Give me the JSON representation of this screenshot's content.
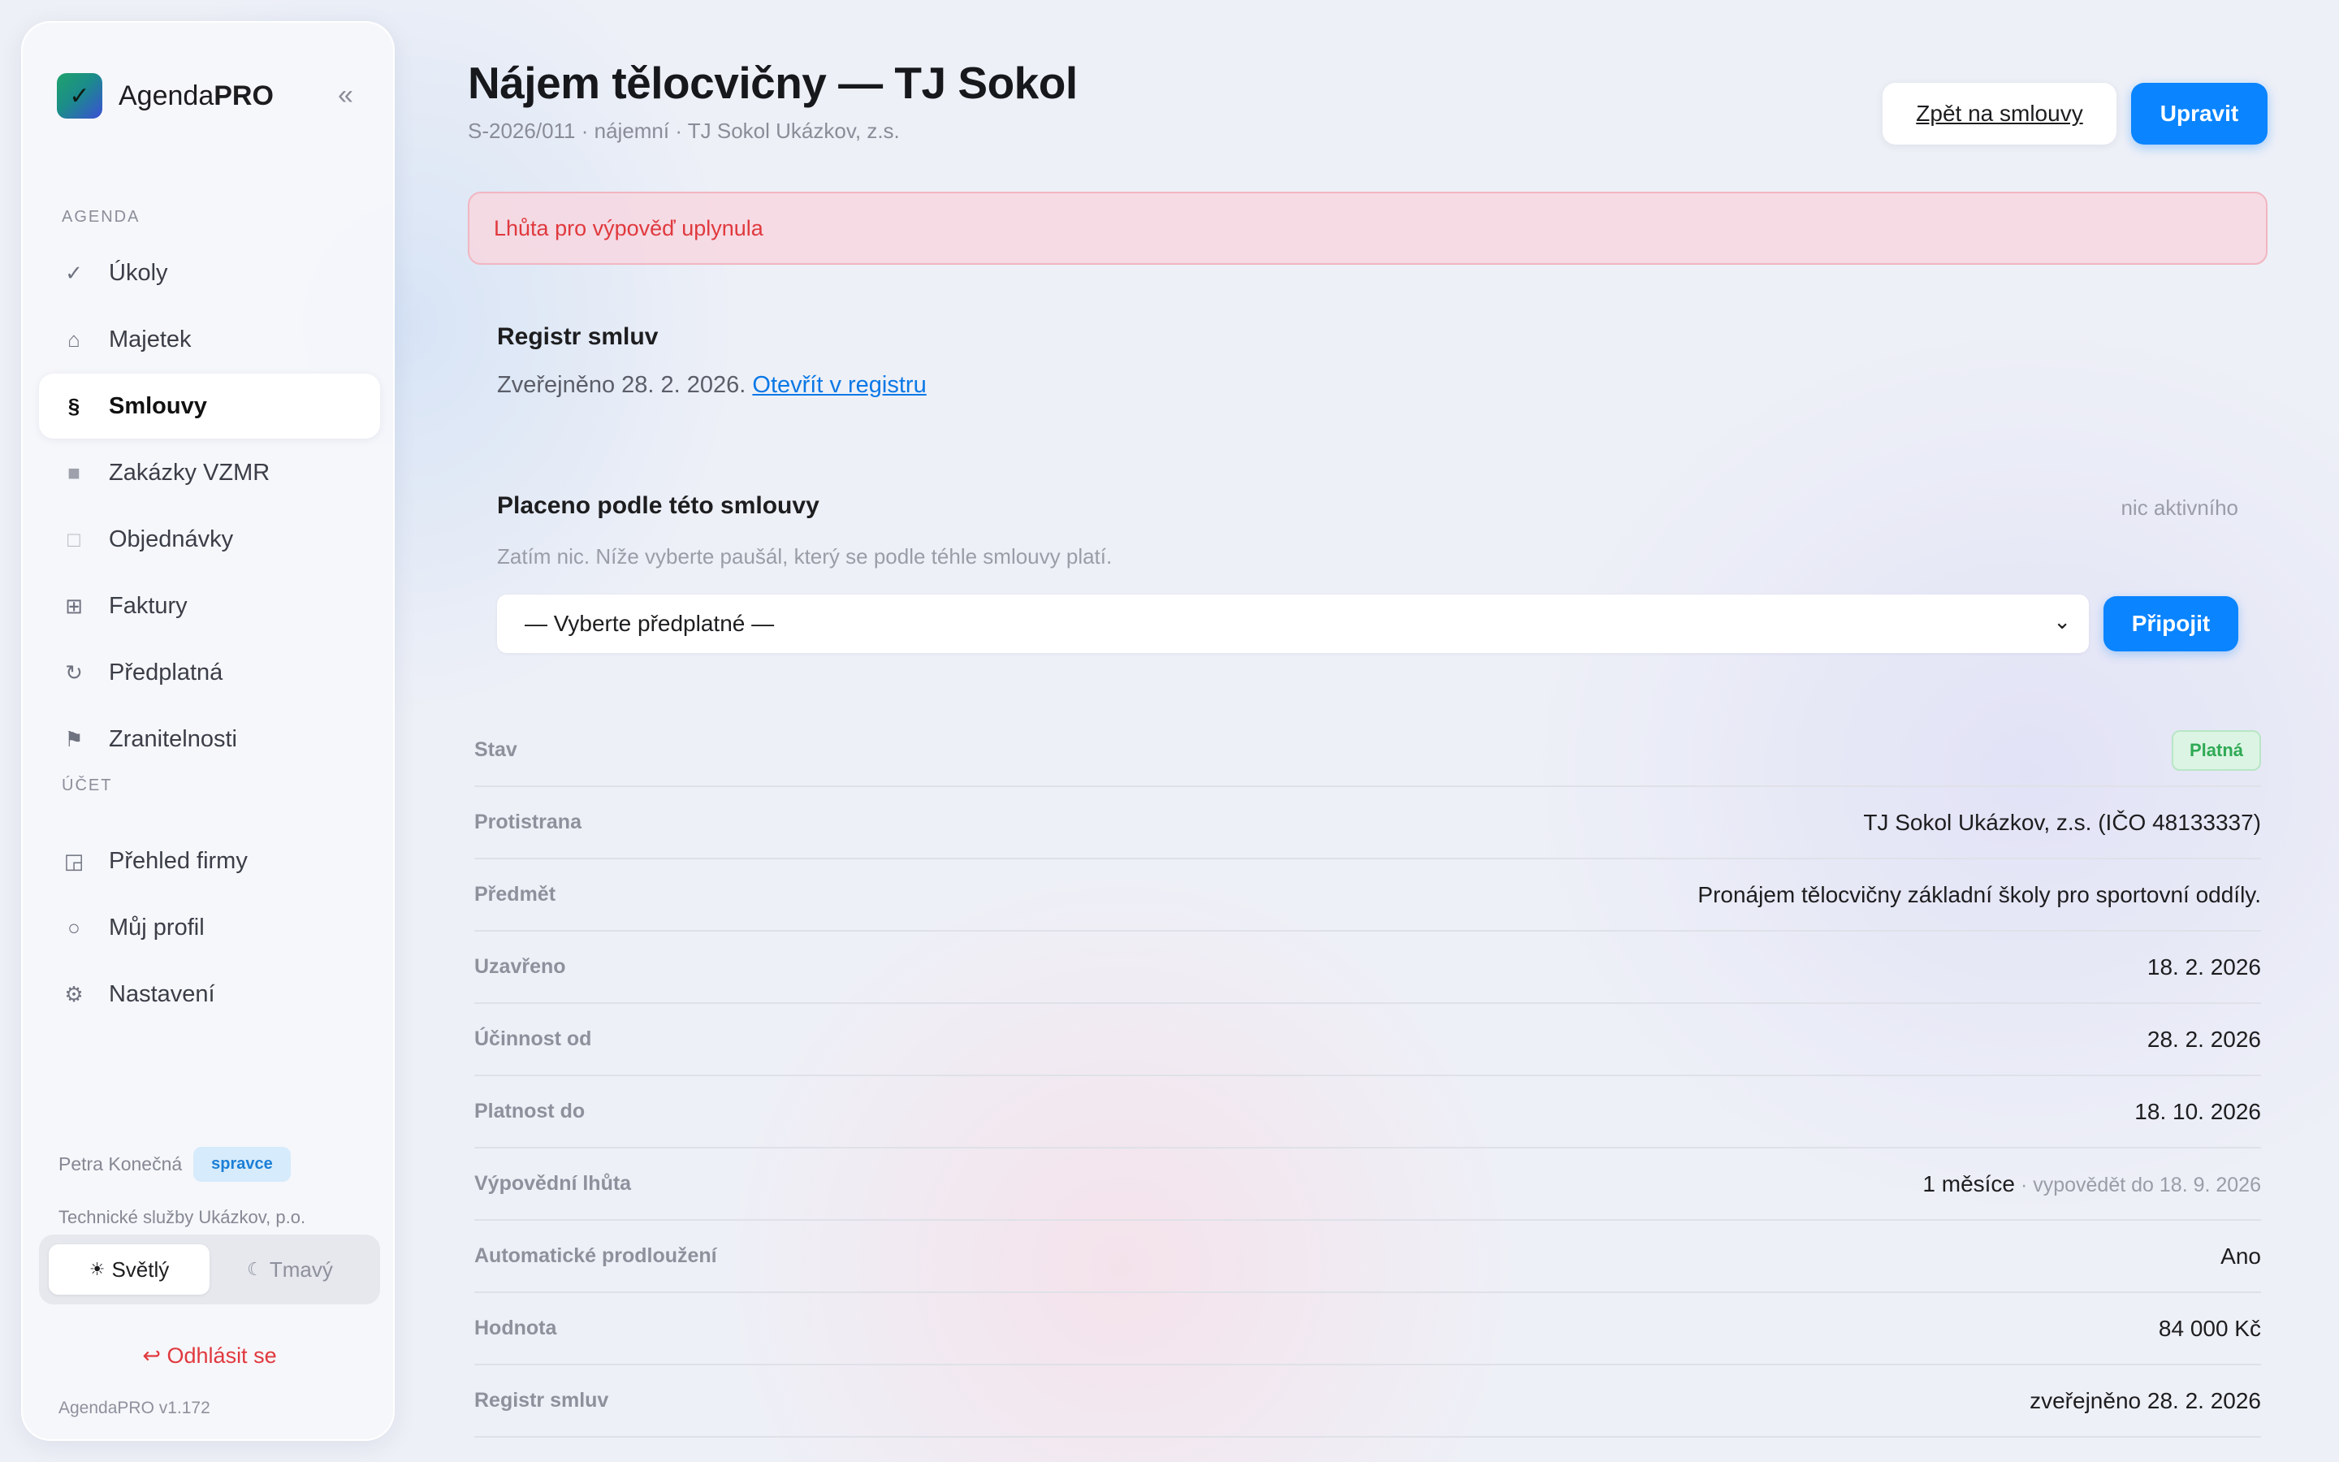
{
  "sidebar": {
    "brand": {
      "prefix": "Agenda",
      "suffix": "PRO",
      "logo_icon": "checkmark"
    },
    "collapse_icon": "«",
    "sections": {
      "agenda": "AGENDA",
      "account": "ÚČET"
    },
    "items": [
      {
        "icon": "✓",
        "label": "Úkoly"
      },
      {
        "icon": "⌂",
        "label": "Majetek"
      },
      {
        "icon": "§",
        "label": "Smlouvy"
      },
      {
        "icon": "■",
        "label": "Zakázky VZMR"
      },
      {
        "icon": "□",
        "label": "Objednávky"
      },
      {
        "icon": "⊞",
        "label": "Faktury"
      },
      {
        "icon": "↻",
        "label": "Předplatná"
      },
      {
        "icon": "⚑",
        "label": "Zranitelnosti"
      }
    ],
    "account_items": [
      {
        "icon": "◲",
        "label": "Přehled firmy"
      },
      {
        "icon": "○",
        "label": "Můj profil"
      },
      {
        "icon": "⚙",
        "label": "Nastavení"
      }
    ],
    "user": {
      "name": "Petra Konečná",
      "role": "spravce",
      "org": "Technické služby Ukázkov, p.o."
    },
    "theme": {
      "light": "Světlý",
      "dark": "Tmavý",
      "light_icon": "☀",
      "dark_icon": "☾"
    },
    "logout": "↩ Odhlásit se",
    "version": "AgendaPRO v1.172"
  },
  "header": {
    "title": "Nájem tělocvičny — TJ Sokol",
    "subtitle": "S-2026/011 · nájemní · TJ Sokol Ukázkov, z.s.",
    "back_label": "Zpět na smlouvy",
    "edit_label": "Upravit"
  },
  "alert": "Lhůta pro výpověď uplynula",
  "registry": {
    "title": "Registr smluv",
    "text": "Zveřejněno 28. 2. 2026.",
    "link": "Otevřít v registru"
  },
  "paid": {
    "title": "Placeno podle této smlouvy",
    "state": "nic aktivního",
    "hint": "Zatím nic. Níže vyberte paušál, který se podle téhle smlouvy platí.",
    "select_value": "— Vyberte předplatné —",
    "attach_label": "Připojit"
  },
  "details": {
    "status": {
      "label": "Stav",
      "value": "Platná"
    },
    "rows": [
      {
        "label": "Protistrana",
        "value": "TJ Sokol Ukázkov, z.s. (IČO 48133337)",
        "note": ""
      },
      {
        "label": "Předmět",
        "value": "Pronájem tělocvičny základní školy pro sportovní oddíly.",
        "note": ""
      },
      {
        "label": "Uzavřeno",
        "value": "18. 2. 2026",
        "note": ""
      },
      {
        "label": "Účinnost od",
        "value": "28. 2. 2026",
        "note": ""
      },
      {
        "label": "Platnost do",
        "value": "18. 10. 2026",
        "note": ""
      },
      {
        "label": "Výpovědní lhůta",
        "value": "1 měsíce",
        "note": " · vypovědět do 18. 9. 2026"
      },
      {
        "label": "Automatické prodloužení",
        "value": "Ano",
        "note": ""
      },
      {
        "label": "Hodnota",
        "value": "84 000 Kč",
        "note": ""
      },
      {
        "label": "Registr smluv",
        "value": "zveřejněno 28. 2. 2026",
        "note": ""
      }
    ]
  },
  "colors": {
    "accent": "#0a84ff",
    "danger": "#e0393e",
    "success": "#2faa55"
  }
}
